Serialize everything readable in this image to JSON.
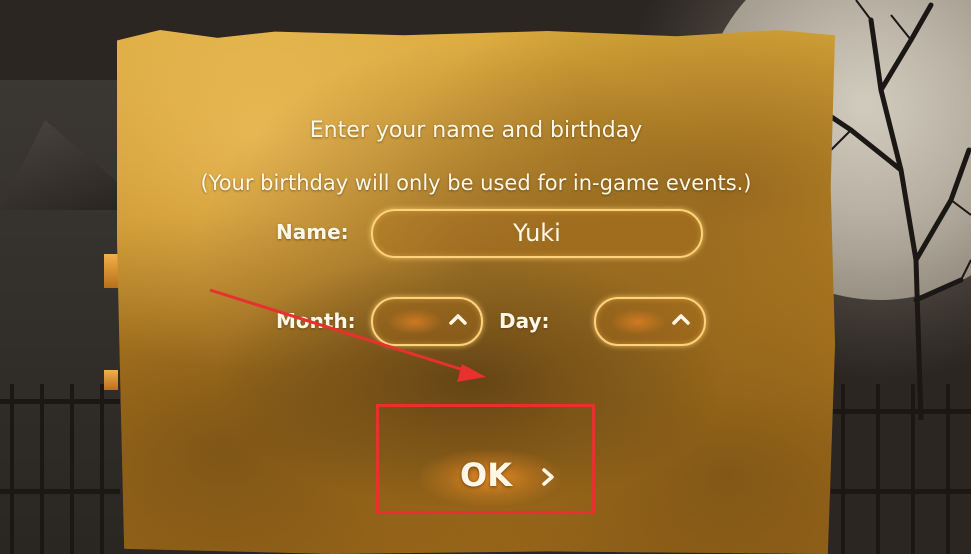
{
  "dialog": {
    "heading": "Enter your name and birthday",
    "note": "(Your birthday will only be used for in-game events.)"
  },
  "form": {
    "name_label": "Name:",
    "name_value": "Yuki",
    "month_label": "Month:",
    "month_value": "",
    "day_label": "Day:",
    "day_value": ""
  },
  "confirm": {
    "label": "OK"
  },
  "icons": {
    "month_picker": "chevron-up-icon",
    "day_picker": "chevron-up-icon",
    "ok_arrow": "chevron-right-icon"
  },
  "colors": {
    "parchment": "#c8922a",
    "field_border": "#ffd27a",
    "text": "#fff8e8",
    "annotation": "#e8302e"
  }
}
